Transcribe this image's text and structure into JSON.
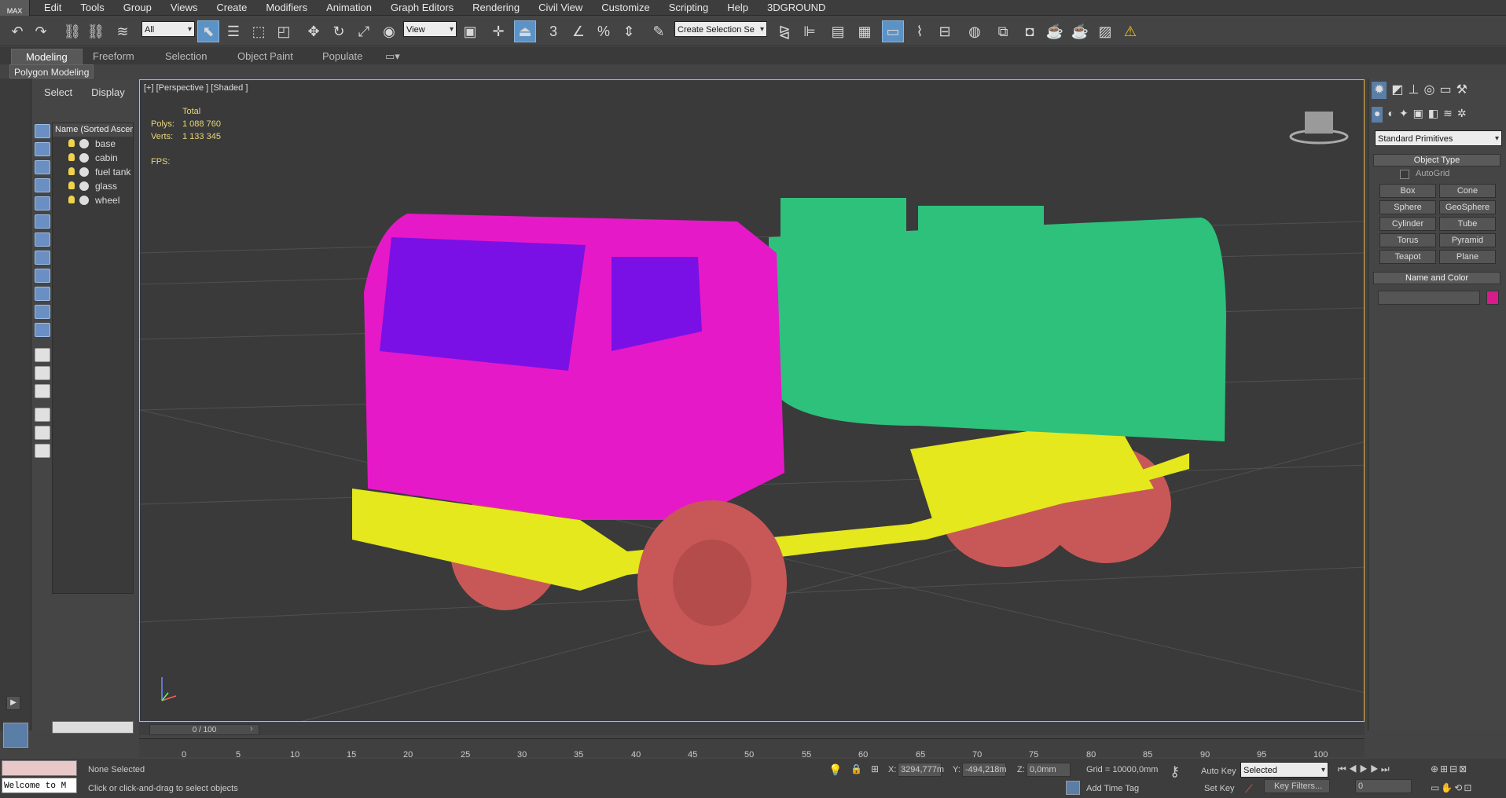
{
  "app": {
    "logo": "MAX"
  },
  "menu": [
    "Edit",
    "Tools",
    "Group",
    "Views",
    "Create",
    "Modifiers",
    "Animation",
    "Graph Editors",
    "Rendering",
    "Civil View",
    "Customize",
    "Scripting",
    "Help",
    "3DGROUND"
  ],
  "toolbar": {
    "filter": "All",
    "refcoord": "View",
    "selset_placeholder": "Create Selection Se",
    "snap_label": "3"
  },
  "ribbon": {
    "tabs": [
      "Modeling",
      "Freeform",
      "Selection",
      "Object Paint",
      "Populate"
    ],
    "sub": "Polygon Modeling"
  },
  "explorer": {
    "tabs": [
      "Select",
      "Display"
    ],
    "header": "Name (Sorted Ascending)",
    "items": [
      "base",
      "cabin",
      "fuel tank",
      "glass",
      "wheel"
    ]
  },
  "viewport": {
    "label": "[+] [Perspective ] [Shaded ]",
    "stats": {
      "total_label": "Total",
      "polys_label": "Polys:",
      "polys": "1 088 760",
      "verts_label": "Verts:",
      "verts": "1 133 345",
      "fps_label": "FPS:"
    }
  },
  "cmdpanel": {
    "category": "Standard Primitives",
    "object_type": "Object Type",
    "autogrid": "AutoGrid",
    "buttons": [
      "Box",
      "Cone",
      "Sphere",
      "GeoSphere",
      "Cylinder",
      "Tube",
      "Torus",
      "Pyramid",
      "Teapot",
      "Plane"
    ],
    "name_color": "Name and Color",
    "swatch": "#d81b8a"
  },
  "time": {
    "slider": "0 / 100",
    "ticks": [
      "0",
      "5",
      "10",
      "15",
      "20",
      "25",
      "30",
      "35",
      "40",
      "45",
      "50",
      "55",
      "60",
      "65",
      "70",
      "75",
      "80",
      "85",
      "90",
      "95",
      "100"
    ]
  },
  "status": {
    "listener": "Welcome to M",
    "selection": "None Selected",
    "prompt": "Click or click-and-drag to select objects",
    "x_label": "X:",
    "x": "3294,777m",
    "y_label": "Y:",
    "y": "-494,218m",
    "z_label": "Z:",
    "z": "0,0mm",
    "grid": "Grid = 10000,0mm",
    "add_time_tag": "Add Time Tag",
    "auto_key": "Auto Key",
    "set_key": "Set Key",
    "key_mode": "Selected",
    "key_filters": "Key Filters...",
    "frame": "0"
  },
  "colors": {
    "cabin": "#e619c8",
    "glass": "#7a10e6",
    "tank": "#2ec17c",
    "base": "#e4e81c",
    "wheel": "#c85858",
    "viewport_border": "#e8b84a"
  }
}
